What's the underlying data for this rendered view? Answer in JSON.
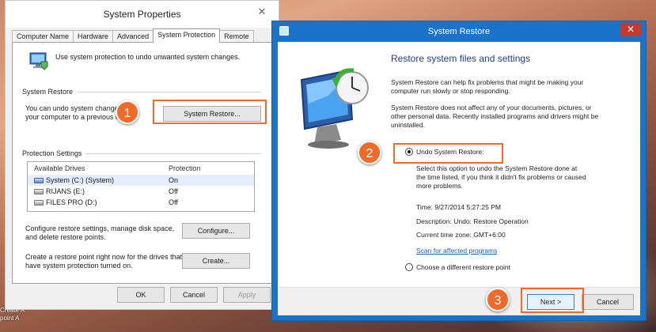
{
  "system_properties": {
    "title": "System Properties",
    "close_label": "✕",
    "tabs": [
      "Computer Name",
      "Hardware",
      "Advanced",
      "System Protection",
      "Remote"
    ],
    "active_tab": "System Protection",
    "intro_text": "Use system protection to undo unwanted system changes.",
    "system_restore": {
      "label": "System Restore",
      "desc_line1": "You can undo system change",
      "desc_line2": "your computer to a previous r",
      "button": "System Restore..."
    },
    "protection_settings": {
      "label": "Protection Settings",
      "col_drives": "Available Drives",
      "col_protection": "Protection",
      "drives": [
        {
          "name": "System (C:) (System)",
          "protection": "On"
        },
        {
          "name": "RIJANS (E:)",
          "protection": "Off"
        },
        {
          "name": "FILES PRO (D:)",
          "protection": "Off"
        }
      ],
      "configure_text_1": "Configure restore settings, manage disk space,",
      "configure_text_2": "and delete restore points.",
      "configure_button": "Configure...",
      "create_text_1": "Create a restore point right now for the drives that",
      "create_text_2": "have system protection turned on.",
      "create_button": "Create..."
    },
    "buttons": {
      "ok": "OK",
      "cancel": "Cancel",
      "apply": "Apply"
    }
  },
  "system_restore_wizard": {
    "title": "System Restore",
    "close_label": "✕",
    "heading": "Restore system files and settings",
    "para1_line1": "System Restore can help fix problems that might be making your",
    "para1_line2": "computer run slowly or stop responding.",
    "para2_line1": "System Restore does not affect any of your documents, pictures, or",
    "para2_line2": "other personal data. Recently installed programs and drivers might be",
    "para2_line3": "uninstalled.",
    "option_undo": "Undo System Restore:",
    "undo_desc_1": "Select this option to undo the System Restore done at",
    "undo_desc_2": "the time listed, if you think it didn't fix problems or caused",
    "undo_desc_3": "more problems.",
    "time": "Time: 9/27/2014 5:27:25 PM",
    "description": "Description: Undo: Restore Operation",
    "timezone": "Current time zone: GMT+6:00",
    "scan_link": "Scan for affected programs",
    "option_choose": "Choose a different restore point",
    "next_button": "Next >",
    "cancel_button": "Cancel"
  },
  "callouts": [
    "1",
    "2",
    "3"
  ],
  "desktop_text": {
    "line1": "Create A",
    "line2": "point A"
  },
  "accent_color": "#f06a2a"
}
